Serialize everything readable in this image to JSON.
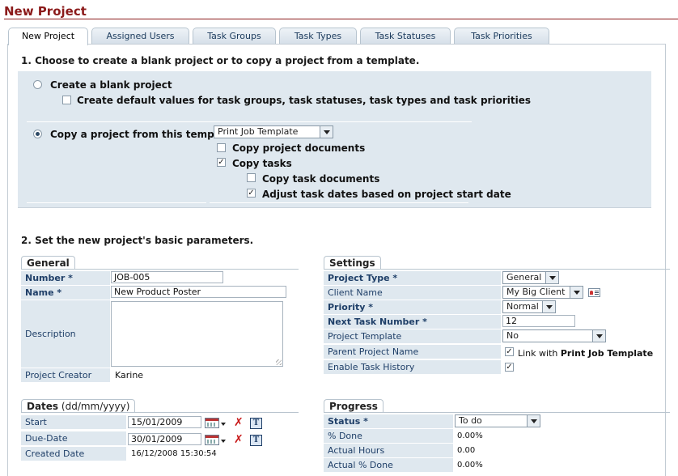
{
  "page": {
    "title": "New Project"
  },
  "tabs": [
    {
      "label": "New Project",
      "active": true
    },
    {
      "label": "Assigned Users"
    },
    {
      "label": "Task Groups"
    },
    {
      "label": "Task Types"
    },
    {
      "label": "Task Statuses"
    },
    {
      "label": "Task Priorities"
    }
  ],
  "section1": {
    "title": "1. Choose to create a blank project or to copy a project from a template.",
    "blank": {
      "label": "Create a blank project",
      "selected": false
    },
    "defaults": {
      "label": "Create default values for task groups, task statuses, task types and task priorities",
      "checked": false
    },
    "copy": {
      "label": "Copy a project from this template",
      "selected": true
    },
    "template_select": "Print Job Template",
    "copy_docs": {
      "label": "Copy project documents",
      "checked": false
    },
    "copy_tasks": {
      "label": "Copy tasks",
      "checked": true
    },
    "copy_task_docs": {
      "label": "Copy task documents",
      "checked": false
    },
    "adjust_dates": {
      "label": "Adjust task dates based on project start date",
      "checked": true
    }
  },
  "section2": {
    "title": "2. Set the new project's basic parameters."
  },
  "general": {
    "title": "General",
    "number_label": "Number *",
    "number_value": "JOB-005",
    "name_label": "Name *",
    "name_value": "New Product Poster",
    "description_label": "Description",
    "description_value": "",
    "creator_label": "Project Creator",
    "creator_value": "Karine"
  },
  "settings": {
    "title": "Settings",
    "project_type_label": "Project Type *",
    "project_type_value": "General",
    "client_label": "Client Name",
    "client_value": "My Big Client",
    "priority_label": "Priority *",
    "priority_value": "Normal",
    "next_task_label": "Next Task Number *",
    "next_task_value": "12",
    "template_label": "Project Template",
    "template_value": "No",
    "parent_label": "Parent Project Name",
    "parent_link_prefix": "Link with",
    "parent_link_name": "Print Job Template",
    "parent_checked": true,
    "history_label": "Enable Task History",
    "history_checked": true
  },
  "dates": {
    "title": "Dates",
    "format": "(dd/mm/yyyy)",
    "start_label": "Start",
    "start_value": "15/01/2009",
    "due_label": "Due-Date",
    "due_value": "30/01/2009",
    "created_label": "Created Date",
    "created_value": "16/12/2008 15:30:54"
  },
  "progress": {
    "title": "Progress",
    "status_label": "Status *",
    "status_value": "To do",
    "done_label": "% Done",
    "done_value": "0.00%",
    "hours_label": "Actual Hours",
    "hours_value": "0.00",
    "actual_done_label": "Actual % Done",
    "actual_done_value": "0.00%"
  },
  "icons": {
    "radio": "radio-button",
    "checkbox": "checkbox",
    "calendar": "calendar-icon",
    "clear": "clear-x-icon",
    "today": "today-icon",
    "client_card": "client-card-icon"
  },
  "colors": {
    "title": "#8b1a1a",
    "label_text": "#1f3f68",
    "label_bg": "#dfe8ef",
    "clear_icon": "#c81818"
  }
}
